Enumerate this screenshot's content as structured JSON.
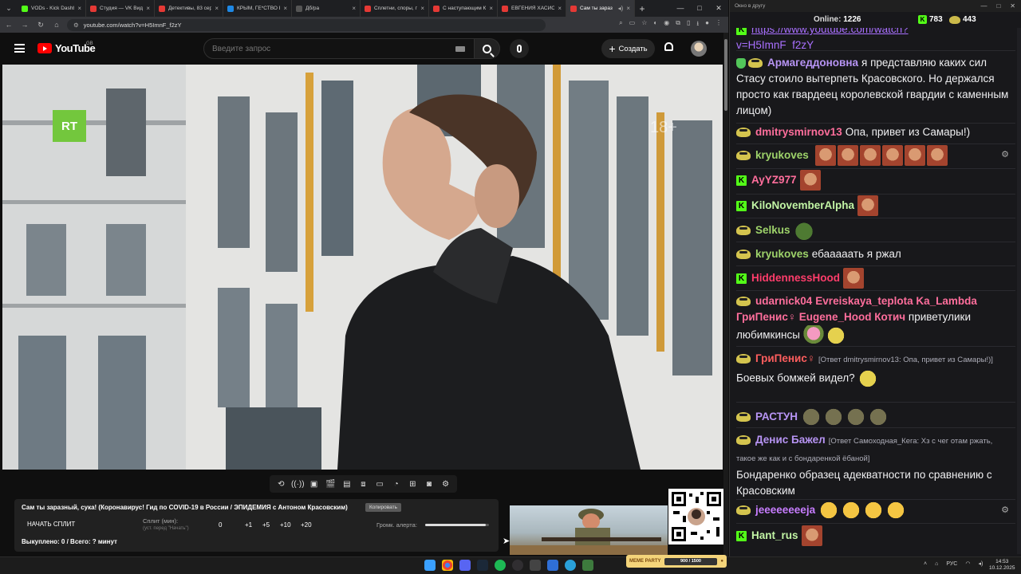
{
  "browser": {
    "tabs": [
      {
        "label": "VODs - Kick Dashb",
        "color": "#53fc18"
      },
      {
        "label": "Студия — VK Видео",
        "color": "#e53935"
      },
      {
        "label": "Детективы, 83 серия",
        "color": "#e53935"
      },
      {
        "label": "КРЫМ, ГЕ*СТВО В",
        "color": "#1e88e5"
      },
      {
        "label": "Дб/ра",
        "color": "#555555"
      },
      {
        "label": "Сплетни, споры, п",
        "color": "#e53935"
      },
      {
        "label": "С наступающим К",
        "color": "#e53935"
      },
      {
        "label": "ЕВГЕНИЯ ХАСИС",
        "color": "#e53935"
      },
      {
        "label": "Сам ты зараз",
        "color": "#e53935"
      }
    ],
    "new_tab": "+",
    "url": "youtube.com/watch?v=H5ImnF_f2zY"
  },
  "youtube": {
    "logo_text": "YouTube",
    "region": "GB",
    "search_placeholder": "Введите запрос",
    "create_label": "Создать"
  },
  "video": {
    "channel_logo": "RT",
    "age_rating": "18+"
  },
  "split_panel": {
    "title": "Сам ты заразный, сука! (Коронавирус! Гид по COVID-19 в России / ЭПИДЕМИЯ с Антоном Красовским)",
    "copy_label": "Копировать",
    "start_split": "НАЧАТЬ СПЛИТ",
    "split_label": "Сплит (мин):",
    "split_sub": "(уст. перед \"Начать\")",
    "split_value": "0",
    "increments": [
      "+1",
      "+5",
      "+10",
      "+20"
    ],
    "alert_label": "Громк. алерта:",
    "alert_level": 0.95,
    "bought": "Выкуплено: 0 / Всего: ? минут"
  },
  "widget": {
    "meme_label": "MEME PARTY",
    "progress_text": "900 / 1500"
  },
  "chat": {
    "window_title": "Окно в другу",
    "online_label": "Online:",
    "online_count": "1226",
    "kick_count": "783",
    "pepe_count": "443",
    "messages": [
      {
        "user": "",
        "color": "#a970ff",
        "text": "v=H5ImnF_f2zY",
        "link": "https://www.youtube.com/watch?"
      },
      {
        "user": "Армагеддоновна",
        "color": "#b794f4",
        "text": "я представляю каких сил Стасу стоило вытерпеть Красовского. Но держался просто как гвардеец королевской гвардии с каменным лицом)"
      },
      {
        "user": "dmitrysmirnov13",
        "color": "#ff6e9c",
        "text": "Опа, привет из Самары!)"
      },
      {
        "user": "kryukoves",
        "color": "#9ed36a",
        "text": ""
      },
      {
        "user": "AyYZ977",
        "color": "#ff6e9c",
        "text": ""
      },
      {
        "user": "KiloNovemberAlpha",
        "color": "#c2f5a5",
        "text": ""
      },
      {
        "user": "Selkus",
        "color": "#9ed36a",
        "text": ""
      },
      {
        "user": "kryukoves",
        "color": "#9ed36a",
        "text": "ебааааать я ржал"
      },
      {
        "user": "HiddennessHood",
        "color": "#ff3d6b",
        "text": ""
      },
      {
        "user": "udarnick04",
        "color": "#ff6e9c",
        "text": "Evreiskaya_teplota Ka_Lambda ГриПенис♀ Eugene_Hood Котич",
        "text2": "приветулики любимкинсы"
      },
      {
        "user": "ГриПенис♀",
        "color": "#ff5e5e",
        "reply": "[Ответ dmitrysmirnov13: Опа, привет из Самары!)]",
        "text": "Боевых бомжей видел?"
      },
      {
        "user": "РАСТУН",
        "color": "#b794f4",
        "text": ""
      },
      {
        "user": "Денис Бажел",
        "color": "#b794f4",
        "reply": "[Ответ Самоходная_Кега: Хз с чег отам ржать, такое же как и с бондаренкой ёбаной]",
        "text": "Бондаренко образец адекватности по сравнению с Красовским"
      },
      {
        "user": "jeeeeeeeeja",
        "color": "#c77dff",
        "text": ""
      },
      {
        "user": "Hant_rus",
        "color": "#c2f5a5",
        "text": ""
      }
    ]
  },
  "taskbar": {
    "lang": "РУС",
    "time": "14:53",
    "date": "10.12.2025"
  }
}
